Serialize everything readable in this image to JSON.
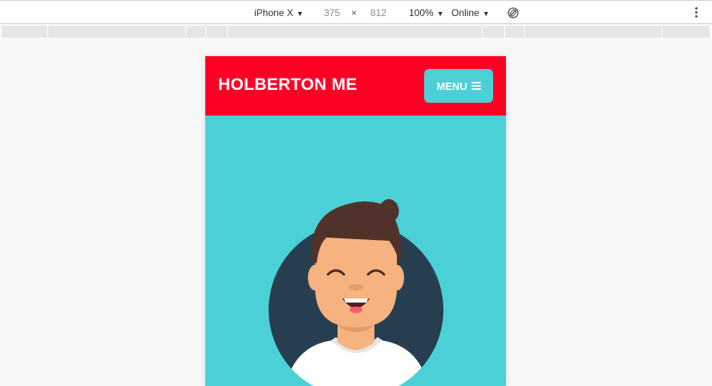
{
  "toolbar": {
    "device": "iPhone X",
    "width": "375",
    "separator": "×",
    "height": "812",
    "zoom": "100%",
    "network": "Online",
    "rotate_icon": "rotate-disabled-icon",
    "more_icon": "kebab-menu-icon"
  },
  "site": {
    "title": "HOLBERTON ME",
    "menu_label": "MENU",
    "menu_icon": "hamburger-icon",
    "colors": {
      "header": "#ff0025",
      "hero": "#4bd0d6",
      "menu_button": "#4bd0d6",
      "avatar_circle": "#263e50"
    }
  }
}
